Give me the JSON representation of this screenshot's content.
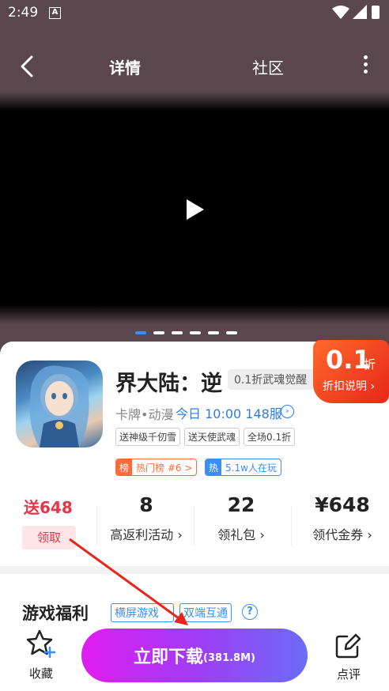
{
  "status": {
    "time": "2:49"
  },
  "nav": {
    "title": "详情",
    "community": "社区"
  },
  "carousel": {
    "slide_count": 6,
    "active_index": 0
  },
  "game": {
    "name": "界大陆：逆转",
    "discount_tag": "0.1折武魂觉醒",
    "genre": "卡牌•动漫",
    "server": "今日 10:00 148服",
    "tags": [
      "送神级千仞雪",
      "送天使武魂",
      "全场0.1折"
    ],
    "rank_key": "榜",
    "rank_value": "热门榜 #6 >",
    "hot_key": "热",
    "hot_value": "5.1w人在玩"
  },
  "discount_corner": {
    "value": "0.1",
    "unit": "折",
    "note": "折扣说明 ›"
  },
  "stats": {
    "gift": {
      "num": "送648",
      "button": "领取"
    },
    "rebate": {
      "num": "8",
      "label": "高返利活动 ›"
    },
    "packs": {
      "num": "22",
      "label": "领礼包 ›"
    },
    "voucher": {
      "num": "¥648",
      "label": "领代金券 ›"
    }
  },
  "welfare": {
    "title": "游戏福利",
    "tag1": "横屏游戏",
    "tag2": "双端互通",
    "help": "?"
  },
  "bottom": {
    "fav_label": "收藏",
    "download": "立即下载",
    "size": "(381.8M)",
    "review_label": "点评"
  },
  "colors": {
    "accent_blue": "#3b8ef5",
    "accent_red": "#e8344a",
    "download_start": "#e01cf0",
    "download_end": "#6b6cf6",
    "annotation_arrow": "#e8261a"
  }
}
